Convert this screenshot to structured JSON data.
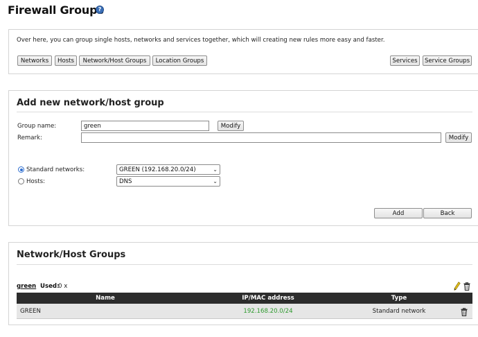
{
  "header": {
    "title": "Firewall Groups",
    "help_icon": "question-circle-icon"
  },
  "intro": {
    "text": "Over here, you can group single hosts, networks and services together, which will creating new rules more easy and faster.",
    "nav_buttons": [
      "Networks",
      "Hosts",
      "Network/Host Groups",
      "Location Groups"
    ],
    "right_buttons": [
      "Services",
      "Service Groups"
    ]
  },
  "add_group": {
    "title": "Add new network/host group",
    "group_name_label": "Group name:",
    "group_name_value": "green",
    "modify_label": "Modify",
    "remark_label": "Remark:",
    "remark_value": "",
    "standard_networks_label": "Standard networks:",
    "standard_networks_value": "GREEN (192.168.20.0/24)",
    "hosts_label": "Hosts:",
    "hosts_value": "DNS",
    "selected_option": "Standard networks",
    "add_label": "Add",
    "back_label": "Back"
  },
  "groups": {
    "title": "Network/Host Groups",
    "group_name": "green",
    "used_label": "Used:",
    "used_count": "0 x",
    "columns": [
      "Name",
      "IP/MAC address",
      "Type"
    ],
    "rows": [
      {
        "name": "GREEN",
        "address": "192.168.20.0/24",
        "type": "Standard network"
      }
    ],
    "address_color": "#2e9a2e"
  }
}
